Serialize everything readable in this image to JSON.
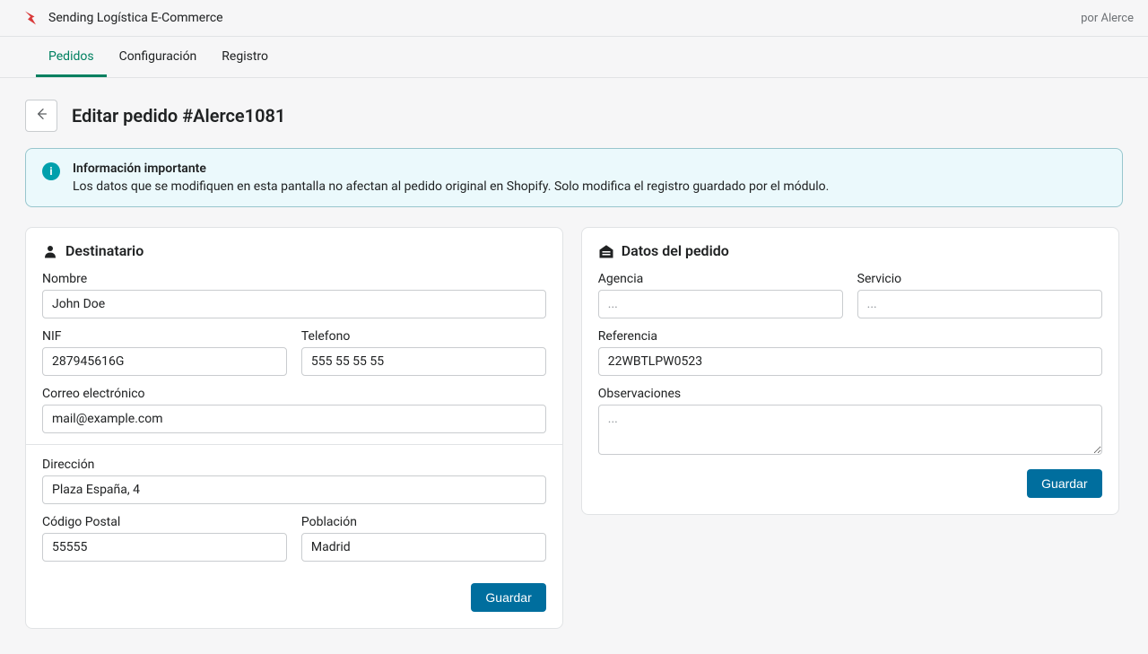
{
  "header": {
    "app_title": "Sending Logística E-Commerce",
    "attribution": "por Alerce"
  },
  "tabs": [
    {
      "label": "Pedidos",
      "active": true
    },
    {
      "label": "Configuración",
      "active": false
    },
    {
      "label": "Registro",
      "active": false
    }
  ],
  "page": {
    "title": "Editar pedido #Alerce1081"
  },
  "banner": {
    "title": "Información importante",
    "text": "Los datos que se modifiquen en esta pantalla no afectan al pedido original en Shopify. Solo modifica el registro guardado por el módulo."
  },
  "recipient": {
    "section_title": "Destinatario",
    "name_label": "Nombre",
    "name_value": "John Doe",
    "nif_label": "NIF",
    "nif_value": "287945616G",
    "phone_label": "Telefono",
    "phone_value": "555 55 55 55",
    "email_label": "Correo electrónico",
    "email_value": "mail@example.com",
    "address_label": "Dirección",
    "address_value": "Plaza España, 4",
    "postal_label": "Código Postal",
    "postal_value": "55555",
    "city_label": "Población",
    "city_value": "Madrid",
    "save_label": "Guardar"
  },
  "order": {
    "section_title": "Datos del pedido",
    "agency_label": "Agencia",
    "agency_value": "",
    "agency_placeholder": "...",
    "service_label": "Servicio",
    "service_value": "",
    "service_placeholder": "...",
    "reference_label": "Referencia",
    "reference_value": "22WBTLPW0523",
    "notes_label": "Observaciones",
    "notes_value": "",
    "notes_placeholder": "...",
    "save_label": "Guardar"
  }
}
